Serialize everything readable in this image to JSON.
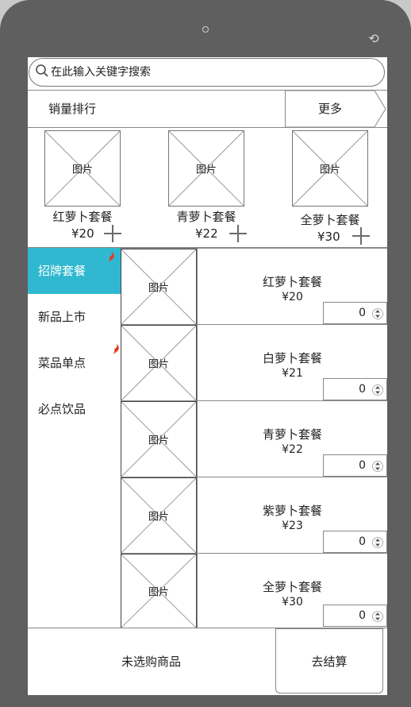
{
  "search": {
    "placeholder": "在此输入关键字搜索"
  },
  "ranking": {
    "title": "销量排行",
    "more_label": "更多"
  },
  "hot_items": [
    {
      "image_label": "图片",
      "name": "红萝卜套餐",
      "price": "¥20"
    },
    {
      "image_label": "图片",
      "name": "青萝卜套餐",
      "price": "¥22"
    },
    {
      "image_label": "图片",
      "name": "全萝卜套餐",
      "price": "¥30"
    }
  ],
  "categories": [
    {
      "label": "招牌套餐",
      "active": true,
      "badge": true
    },
    {
      "label": "新品上市",
      "active": false,
      "badge": false
    },
    {
      "label": "菜品单点",
      "active": false,
      "badge": true
    },
    {
      "label": "必点饮品",
      "active": false,
      "badge": false
    }
  ],
  "products": [
    {
      "image_label": "图片",
      "name": "红萝卜套餐",
      "price": "¥20",
      "qty": "0"
    },
    {
      "image_label": "图片",
      "name": "白萝卜套餐",
      "price": "¥21",
      "qty": "0"
    },
    {
      "image_label": "图片",
      "name": "青萝卜套餐",
      "price": "¥22",
      "qty": "0"
    },
    {
      "image_label": "图片",
      "name": "紫萝卜套餐",
      "price": "¥23",
      "qty": "0"
    },
    {
      "image_label": "图片",
      "name": "全萝卜套餐",
      "price": "¥30",
      "qty": "0"
    }
  ],
  "footer": {
    "status": "未选购商品",
    "checkout_label": "去结算"
  },
  "colors": {
    "accent": "#30b8d0",
    "badge": "#e53b1e",
    "frame": "#5f5f5f"
  },
  "icons": {
    "search": "search-icon",
    "add": "plus-icon",
    "rotate": "rotate-icon",
    "hot": "flame-icon",
    "stepper": "stepper-arrows-icon"
  }
}
